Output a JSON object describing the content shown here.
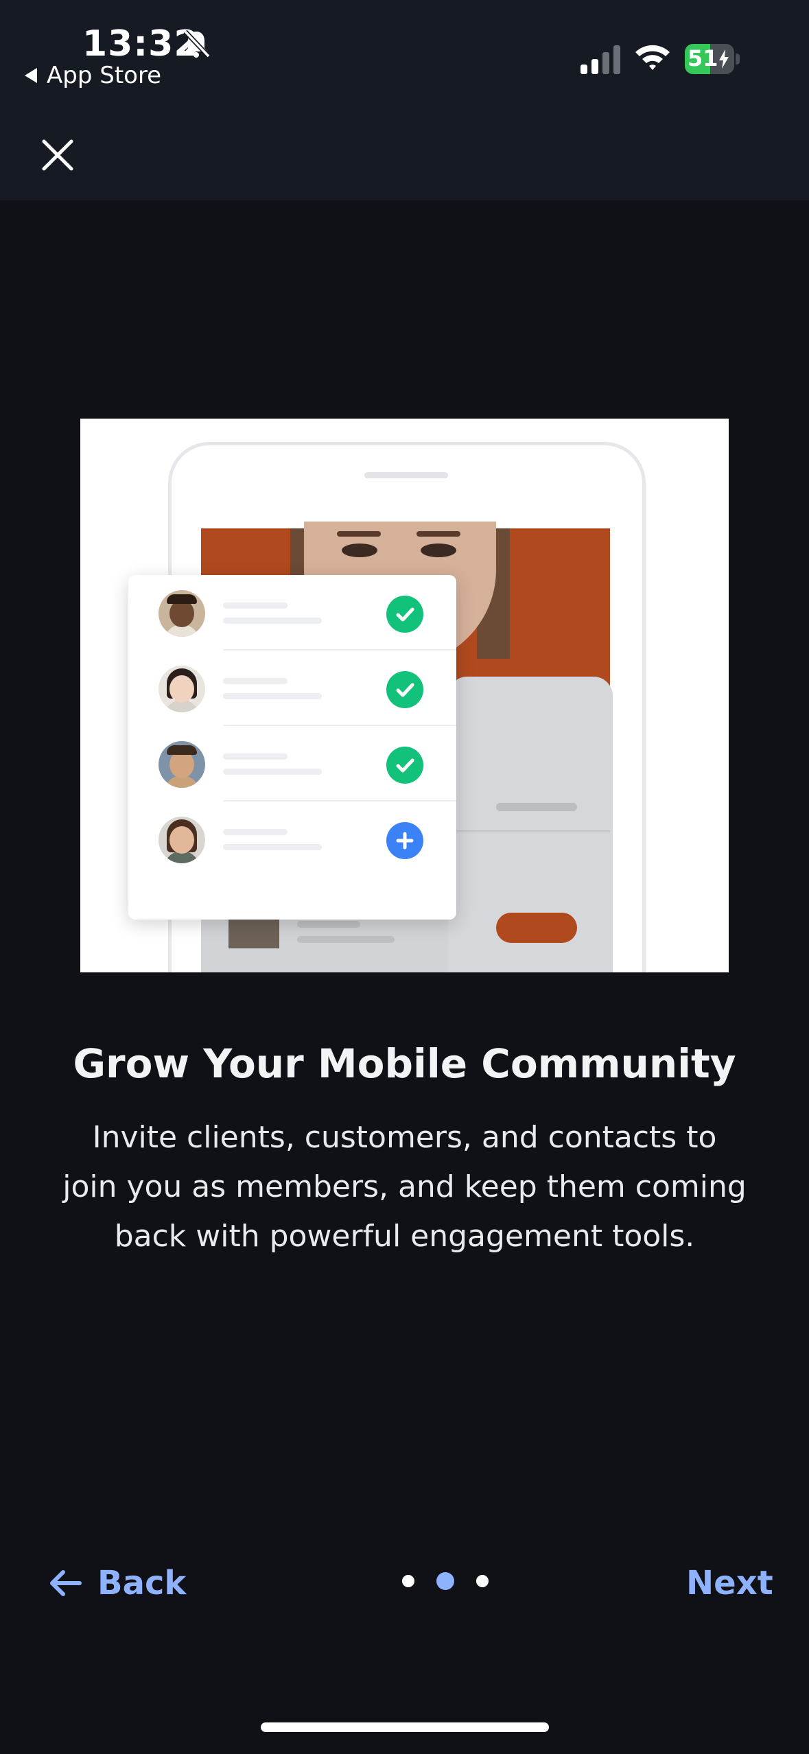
{
  "status_bar": {
    "time": "13:32",
    "back_app": "App Store",
    "battery": "51",
    "battery_level": 0.51
  },
  "header": {
    "close_icon": "close-icon"
  },
  "illustration": {
    "members": [
      {
        "status": "checked",
        "status_icon": "check-icon"
      },
      {
        "status": "checked",
        "status_icon": "check-icon"
      },
      {
        "status": "checked",
        "status_icon": "check-icon"
      },
      {
        "status": "add",
        "status_icon": "plus-icon"
      }
    ],
    "colors": {
      "check": "#12c27a",
      "add": "#3a82f6",
      "brand_orange": "#b04a1e"
    }
  },
  "content": {
    "title": "Grow Your Mobile Community",
    "description": "Invite clients, customers, and contacts to join you as members, and keep them coming back with powerful engagement tools."
  },
  "navigation": {
    "back_label": "Back",
    "next_label": "Next",
    "page_count": 3,
    "current_page": 2,
    "accent": "#8fb2ff"
  }
}
